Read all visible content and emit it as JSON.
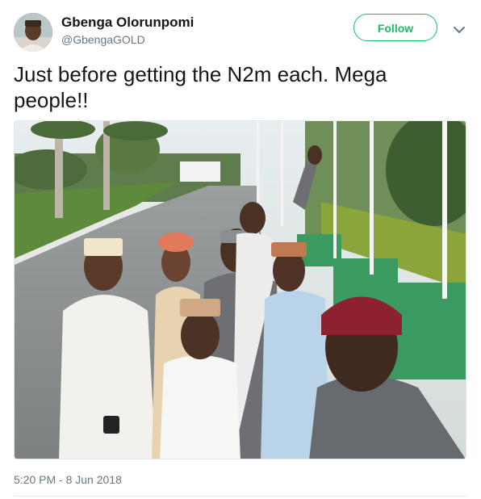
{
  "user": {
    "name": "Gbenga Olorunpomi",
    "handle": "@GbengaGOLD"
  },
  "actions": {
    "follow_label": "Follow"
  },
  "tweet": {
    "text": "Just before getting the N2m each. Mega people!!",
    "timestamp": "5:20 PM - 8 Jun 2018"
  },
  "colors": {
    "follow_green": "#17bf63",
    "secondary_text": "#657786",
    "primary_text": "#14171a"
  },
  "icons": {
    "more": "chevron-down-icon"
  }
}
